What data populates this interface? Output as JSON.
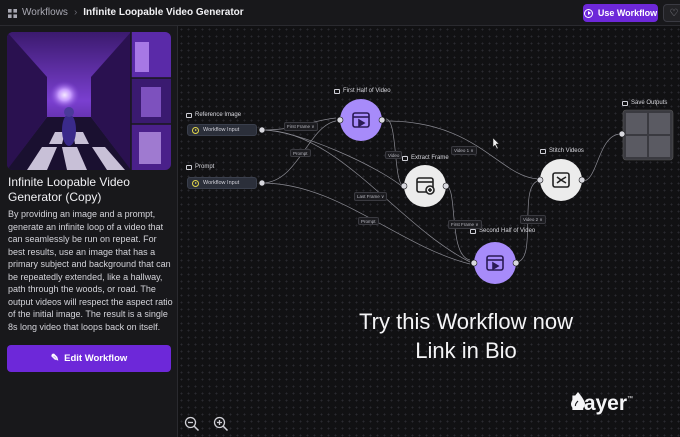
{
  "topbar": {
    "back_label": "Workflows",
    "separator": "›",
    "current": "Infinite Loopable Video Generator",
    "use_label": "Use Workflow"
  },
  "left": {
    "title": "Infinite Loopable Video Generator (Copy)",
    "description": "By providing an image and a prompt, generate an infinite loop of a video that can seamlessly be run on repeat. For best results, use an image that has a primary subject and background that can be repeatedly extended, like a hallway, path through the woods, or road. The output videos will respect the aspect ratio of the initial image. The result is a single 8s long video that loops back on itself.",
    "edit_label": "Edit Workflow"
  },
  "canvas": {
    "nodes": {
      "reference_image": {
        "label": "Reference Image",
        "input": "Workflow Input"
      },
      "prompt": {
        "label": "Prompt",
        "input": "Workflow Input"
      },
      "first_half": {
        "label": "First Half of Video"
      },
      "extract_frame": {
        "label": "Extract Frame"
      },
      "second_half": {
        "label": "Second Half of Video"
      },
      "stitch": {
        "label": "Stitch Videos"
      },
      "save": {
        "label": "Save Outputs"
      }
    },
    "edge_tags": {
      "first_frame": "First Frame ∨",
      "prompt_a": "Prompt",
      "video": "Video",
      "video1": "Video 1 ∨",
      "last_frame": "Last Frame ∨",
      "prompt_b": "Prompt",
      "first_frame_b": "First Frame ∨",
      "video2": "Video 2 ∨"
    },
    "overlay_line1": "Try this Workflow now",
    "overlay_line2": "Link in Bio",
    "brand": "Layer",
    "brand_mark": "™"
  },
  "colors": {
    "accent": "#6d28d9",
    "node_purple": "#a78bfa",
    "node_white": "#e5e5e5"
  },
  "icons": [
    "grid-icon",
    "play-icon",
    "heart-icon",
    "pencil-icon",
    "zoom-out-icon",
    "zoom-in-icon",
    "video-icon",
    "layer-drop-icon"
  ]
}
